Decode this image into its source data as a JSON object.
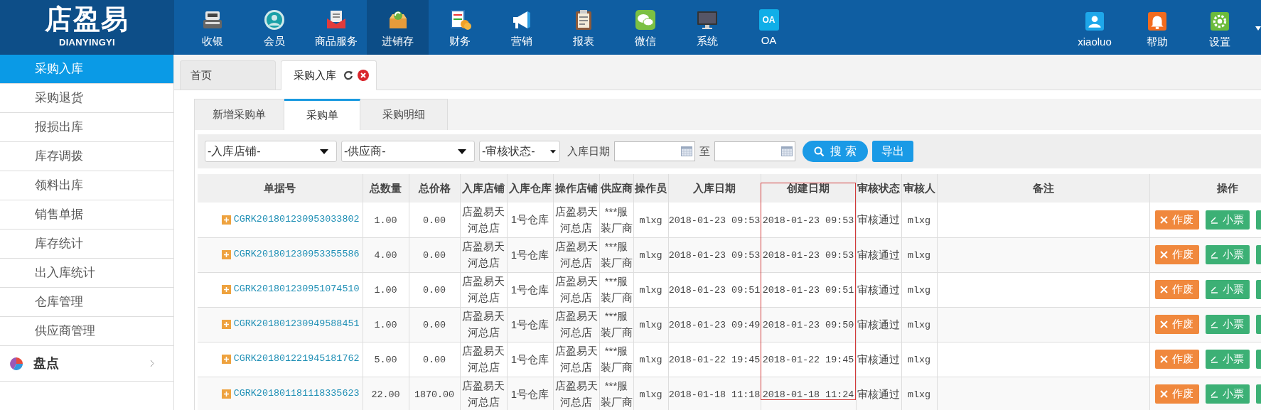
{
  "logo": {
    "name": "店盈易",
    "subtitle": "DIANYINGYI"
  },
  "nav": [
    {
      "label": "收银",
      "selected": false
    },
    {
      "label": "会员",
      "selected": false
    },
    {
      "label": "商品服务",
      "selected": false
    },
    {
      "label": "进销存",
      "selected": true
    },
    {
      "label": "财务",
      "selected": false
    },
    {
      "label": "营销",
      "selected": false
    },
    {
      "label": "报表",
      "selected": false
    },
    {
      "label": "微信",
      "selected": false
    },
    {
      "label": "系统",
      "selected": false
    },
    {
      "label": "OA",
      "selected": false,
      "icon_text": "OA"
    }
  ],
  "user_menu": [
    {
      "label": "xiaoluo"
    },
    {
      "label": "帮助"
    },
    {
      "label": "设置"
    }
  ],
  "sidebar": {
    "items": [
      {
        "label": "采购入库",
        "selected": true
      },
      {
        "label": "采购退货",
        "selected": false
      },
      {
        "label": "报损出库",
        "selected": false
      },
      {
        "label": "库存调拨",
        "selected": false
      },
      {
        "label": "领料出库",
        "selected": false
      },
      {
        "label": "销售单据",
        "selected": false
      },
      {
        "label": "库存统计",
        "selected": false
      },
      {
        "label": "出入库统计",
        "selected": false
      },
      {
        "label": "仓库管理",
        "selected": false
      },
      {
        "label": "供应商管理",
        "selected": false
      }
    ],
    "groups": [
      {
        "label": "盘点",
        "expanded": false
      }
    ]
  },
  "page_tabs": [
    {
      "label": "首页",
      "selected": false,
      "closable": false
    },
    {
      "label": "采购入库",
      "selected": true,
      "closable": true
    }
  ],
  "sub_tabs": [
    {
      "label": "新增采购单",
      "selected": false
    },
    {
      "label": "采购单",
      "selected": true
    },
    {
      "label": "采购明细",
      "selected": false
    }
  ],
  "filters": {
    "store": "-入库店铺-",
    "supplier": "-供应商-",
    "status": "-审核状态-",
    "date_label": "入库日期",
    "range_separator": "至",
    "search_button": "搜 索",
    "export_button": "导出"
  },
  "table": {
    "columns": [
      {
        "label": "单据号",
        "highlighted": false
      },
      {
        "label": "总数量",
        "highlighted": false
      },
      {
        "label": "总价格",
        "highlighted": false
      },
      {
        "label": "入库店铺",
        "highlighted": false
      },
      {
        "label": "入库仓库",
        "highlighted": false
      },
      {
        "label": "操作店铺",
        "highlighted": false
      },
      {
        "label": "供应商",
        "highlighted": false
      },
      {
        "label": "操作员",
        "highlighted": false
      },
      {
        "label": "入库日期",
        "highlighted": false
      },
      {
        "label": "创建日期",
        "highlighted": true
      },
      {
        "label": "审核状态",
        "highlighted": false
      },
      {
        "label": "审核人",
        "highlighted": false
      },
      {
        "label": "备注",
        "highlighted": false
      },
      {
        "label": "操作",
        "highlighted": false
      }
    ],
    "rows": [
      {
        "cells": [
          "CGRK201801230953033802",
          "1.00",
          "0.00",
          "店盈易天河总店",
          "1号仓库",
          "店盈易天河总店",
          "***服装厂商",
          "mlxg",
          "2018-01-23 09:53",
          "2018-01-23 09:53",
          "审核通过",
          "mlxg"
        ],
        "actions": [
          "作废",
          "小票"
        ]
      },
      {
        "cells": [
          "CGRK201801230953355586",
          "4.00",
          "0.00",
          "店盈易天河总店",
          "1号仓库",
          "店盈易天河总店",
          "***服装厂商",
          "mlxg",
          "2018-01-23 09:53",
          "2018-01-23 09:53",
          "审核通过",
          "mlxg"
        ],
        "actions": [
          "作废",
          "小票"
        ]
      },
      {
        "cells": [
          "CGRK201801230951074510",
          "1.00",
          "0.00",
          "店盈易天河总店",
          "1号仓库",
          "店盈易天河总店",
          "***服装厂商",
          "mlxg",
          "2018-01-23 09:51",
          "2018-01-23 09:51",
          "审核通过",
          "mlxg"
        ],
        "actions": [
          "作废",
          "小票"
        ]
      },
      {
        "cells": [
          "CGRK201801230949588451",
          "1.00",
          "0.00",
          "店盈易天河总店",
          "1号仓库",
          "店盈易天河总店",
          "***服装厂商",
          "mlxg",
          "2018-01-23 09:49",
          "2018-01-23 09:50",
          "审核通过",
          "mlxg"
        ],
        "actions": [
          "作废",
          "小票"
        ]
      },
      {
        "cells": [
          "CGRK201801221945181762",
          "5.00",
          "0.00",
          "店盈易天河总店",
          "1号仓库",
          "店盈易天河总店",
          "***服装厂商",
          "mlxg",
          "2018-01-22 19:45",
          "2018-01-22 19:45",
          "审核通过",
          "mlxg"
        ],
        "actions": [
          "作废",
          "小票"
        ]
      },
      {
        "cells": [
          "CGRK201801181118335623",
          "22.00",
          "1870.00",
          "店盈易天河总店",
          "1号仓库",
          "店盈易天河总店",
          "***服装厂商",
          "mlxg",
          "2018-01-18 11:18",
          "2018-01-18 11:24",
          "审核通过",
          "mlxg"
        ],
        "actions": [
          "作废",
          "小票"
        ]
      }
    ]
  }
}
